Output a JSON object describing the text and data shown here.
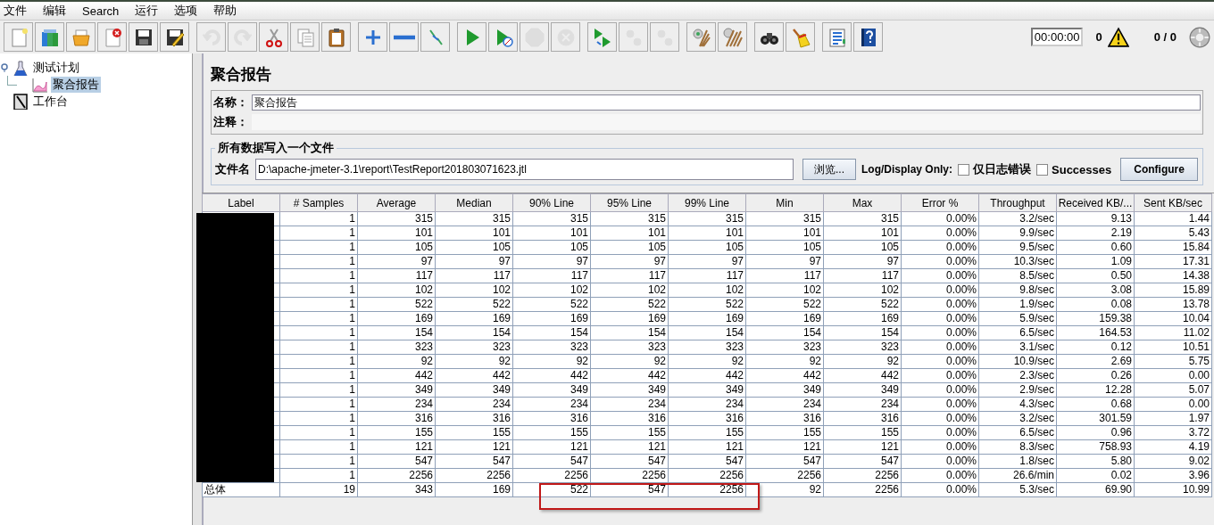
{
  "menu": [
    {
      "label": "文件"
    },
    {
      "label": "编辑"
    },
    {
      "label": "Search"
    },
    {
      "label": "运行"
    },
    {
      "label": "选项"
    },
    {
      "label": "帮助"
    }
  ],
  "toolbar": {
    "groups": [
      [
        {
          "kind": "new",
          "disabled": false
        },
        {
          "kind": "templates",
          "disabled": false
        },
        {
          "kind": "open",
          "disabled": false
        },
        {
          "kind": "close",
          "disabled": false
        },
        {
          "kind": "save",
          "disabled": false
        },
        {
          "kind": "save-as",
          "disabled": false
        }
      ],
      [
        {
          "kind": "undo",
          "disabled": true
        },
        {
          "kind": "redo",
          "disabled": true
        },
        {
          "kind": "cut",
          "disabled": false
        },
        {
          "kind": "copy",
          "disabled": false
        },
        {
          "kind": "paste",
          "disabled": false
        }
      ],
      [
        {
          "kind": "expand",
          "disabled": false
        },
        {
          "kind": "collapse",
          "disabled": false
        },
        {
          "kind": "toggle",
          "disabled": false
        }
      ],
      [
        {
          "kind": "start",
          "disabled": false
        },
        {
          "kind": "start-no-pause",
          "disabled": false
        },
        {
          "kind": "stop",
          "disabled": true
        },
        {
          "kind": "shutdown",
          "disabled": true
        }
      ],
      [
        {
          "kind": "remote-start",
          "disabled": false
        },
        {
          "kind": "remote-stop",
          "disabled": true
        },
        {
          "kind": "remote-exit",
          "disabled": true
        }
      ],
      [
        {
          "kind": "clear",
          "disabled": false
        },
        {
          "kind": "clear-all",
          "disabled": false
        }
      ],
      [
        {
          "kind": "search",
          "disabled": false
        },
        {
          "kind": "reset-search",
          "disabled": false
        }
      ],
      [
        {
          "kind": "functions",
          "disabled": false
        },
        {
          "kind": "help",
          "disabled": false
        }
      ]
    ],
    "timer": "00:00:00",
    "warnings": "0",
    "threads": "0 / 0"
  },
  "tree": [
    {
      "label": "测试计划",
      "kind": "plan",
      "selected": false,
      "expanded": true,
      "children": [
        {
          "label": "聚合报告",
          "kind": "report",
          "selected": true
        }
      ]
    },
    {
      "label": "工作台",
      "kind": "workbench",
      "selected": false
    }
  ],
  "panel": {
    "title": "聚合报告",
    "name_label": "名称：",
    "name_value": "聚合报告",
    "comment_label": "注释：",
    "file_group": {
      "title": "所有数据写入一个文件",
      "file_label": "文件名",
      "file_value": "D:\\apache-jmeter-3.1\\report\\TestReport201803071623.jtl",
      "browse": "浏览...",
      "log_label": "Log/Display Only:",
      "checkboxes": [
        {
          "label": "仅日志错误",
          "checked": false
        },
        {
          "label": "Successes",
          "checked": false
        }
      ],
      "configure": "Configure"
    }
  },
  "table": {
    "columns": [
      "Label",
      "# Samples",
      "Average",
      "Median",
      "90% Line",
      "95% Line",
      "99% Line",
      "Min",
      "Max",
      "Error %",
      "Throughput",
      "Received KB/...",
      "Sent KB/sec"
    ],
    "labels_redacted": true,
    "total_highlighted": true,
    "rows": [
      {
        "cells": [
          "",
          "1",
          "315",
          "315",
          "315",
          "315",
          "315",
          "315",
          "315",
          "0.00%",
          "3.2/sec",
          "9.13",
          "1.44"
        ]
      },
      {
        "cells": [
          "",
          "1",
          "101",
          "101",
          "101",
          "101",
          "101",
          "101",
          "101",
          "0.00%",
          "9.9/sec",
          "2.19",
          "5.43"
        ]
      },
      {
        "cells": [
          "",
          "1",
          "105",
          "105",
          "105",
          "105",
          "105",
          "105",
          "105",
          "0.00%",
          "9.5/sec",
          "0.60",
          "15.84"
        ]
      },
      {
        "cells": [
          "",
          "1",
          "97",
          "97",
          "97",
          "97",
          "97",
          "97",
          "97",
          "0.00%",
          "10.3/sec",
          "1.09",
          "17.31"
        ]
      },
      {
        "cells": [
          "",
          "1",
          "117",
          "117",
          "117",
          "117",
          "117",
          "117",
          "117",
          "0.00%",
          "8.5/sec",
          "0.50",
          "14.38"
        ]
      },
      {
        "cells": [
          "",
          "1",
          "102",
          "102",
          "102",
          "102",
          "102",
          "102",
          "102",
          "0.00%",
          "9.8/sec",
          "3.08",
          "15.89"
        ]
      },
      {
        "cells": [
          "",
          "1",
          "522",
          "522",
          "522",
          "522",
          "522",
          "522",
          "522",
          "0.00%",
          "1.9/sec",
          "0.08",
          "13.78"
        ]
      },
      {
        "cells": [
          "",
          "1",
          "169",
          "169",
          "169",
          "169",
          "169",
          "169",
          "169",
          "0.00%",
          "5.9/sec",
          "159.38",
          "10.04"
        ]
      },
      {
        "cells": [
          "",
          "1",
          "154",
          "154",
          "154",
          "154",
          "154",
          "154",
          "154",
          "0.00%",
          "6.5/sec",
          "164.53",
          "11.02"
        ]
      },
      {
        "cells": [
          "",
          "1",
          "323",
          "323",
          "323",
          "323",
          "323",
          "323",
          "323",
          "0.00%",
          "3.1/sec",
          "0.12",
          "10.51"
        ]
      },
      {
        "cells": [
          "",
          "1",
          "92",
          "92",
          "92",
          "92",
          "92",
          "92",
          "92",
          "0.00%",
          "10.9/sec",
          "2.69",
          "5.75"
        ]
      },
      {
        "cells": [
          "",
          "1",
          "442",
          "442",
          "442",
          "442",
          "442",
          "442",
          "442",
          "0.00%",
          "2.3/sec",
          "0.26",
          "0.00"
        ]
      },
      {
        "cells": [
          "",
          "1",
          "349",
          "349",
          "349",
          "349",
          "349",
          "349",
          "349",
          "0.00%",
          "2.9/sec",
          "12.28",
          "5.07"
        ]
      },
      {
        "cells": [
          "",
          "1",
          "234",
          "234",
          "234",
          "234",
          "234",
          "234",
          "234",
          "0.00%",
          "4.3/sec",
          "0.68",
          "0.00"
        ]
      },
      {
        "cells": [
          "",
          "1",
          "316",
          "316",
          "316",
          "316",
          "316",
          "316",
          "316",
          "0.00%",
          "3.2/sec",
          "301.59",
          "1.97"
        ]
      },
      {
        "cells": [
          "",
          "1",
          "155",
          "155",
          "155",
          "155",
          "155",
          "155",
          "155",
          "0.00%",
          "6.5/sec",
          "0.96",
          "3.72"
        ]
      },
      {
        "cells": [
          "",
          "1",
          "121",
          "121",
          "121",
          "121",
          "121",
          "121",
          "121",
          "0.00%",
          "8.3/sec",
          "758.93",
          "4.19"
        ]
      },
      {
        "cells": [
          "",
          "1",
          "547",
          "547",
          "547",
          "547",
          "547",
          "547",
          "547",
          "0.00%",
          "1.8/sec",
          "5.80",
          "9.02"
        ]
      },
      {
        "cells": [
          "",
          "1",
          "2256",
          "2256",
          "2256",
          "2256",
          "2256",
          "2256",
          "2256",
          "0.00%",
          "26.6/min",
          "0.02",
          "3.96"
        ]
      }
    ],
    "total": {
      "cells": [
        "总体",
        "19",
        "343",
        "169",
        "522",
        "547",
        "2256",
        "92",
        "2256",
        "0.00%",
        "5.3/sec",
        "69.90",
        "10.99"
      ]
    }
  }
}
